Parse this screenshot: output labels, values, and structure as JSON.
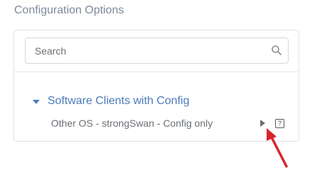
{
  "section": {
    "title": "Configuration Options"
  },
  "search": {
    "placeholder": "Search",
    "value": ""
  },
  "group": {
    "title": "Software Clients with Config",
    "expanded": true,
    "items": [
      {
        "label": "Other OS - strongSwan - Config only",
        "help_glyph": "?"
      }
    ]
  },
  "colors": {
    "accent": "#4b7bb8",
    "annotation_arrow": "#d9232d",
    "muted_text": "#6a6f74",
    "title_text": "#7b8a9a"
  },
  "icons": {
    "search": "magnifier-icon",
    "caret": "caret-down-icon",
    "play": "play-icon",
    "help": "help-icon",
    "annotation": "red-arrow-icon"
  }
}
